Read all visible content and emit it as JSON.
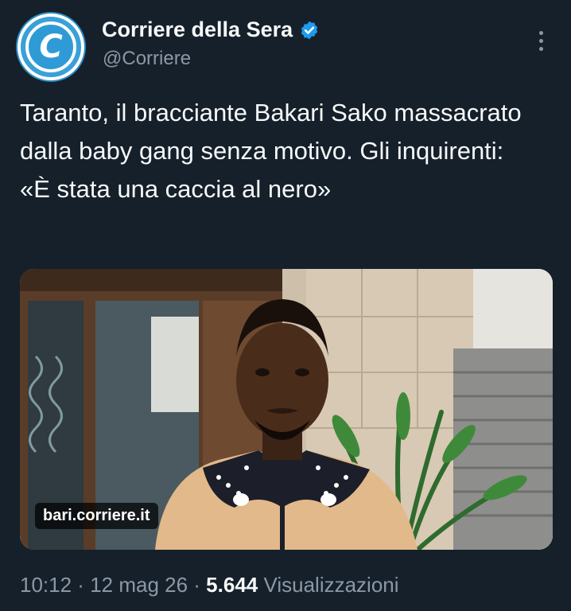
{
  "author": {
    "avatar_letter": "C",
    "name": "Corriere della Sera",
    "handle": "@Corriere",
    "verified_icon": "verified-badge-icon"
  },
  "tweet": {
    "text": "Taranto, il bracciante Bakari Sako massacrato dalla baby gang senza motivo. Gli inquirenti: «È stata una caccia al nero»"
  },
  "media": {
    "link_domain": "bari.corriere.it"
  },
  "meta": {
    "time": "10:12",
    "sep1": " · ",
    "date": "12 mag 26",
    "sep2": " · ",
    "views_count": "5.644",
    "views_label": " Visualizzazioni"
  },
  "colors": {
    "background": "#15202b",
    "text": "#f7f9f9",
    "secondary": "#8b98a5",
    "verified": "#1d9bf0",
    "brand": "#2f9bd6"
  }
}
